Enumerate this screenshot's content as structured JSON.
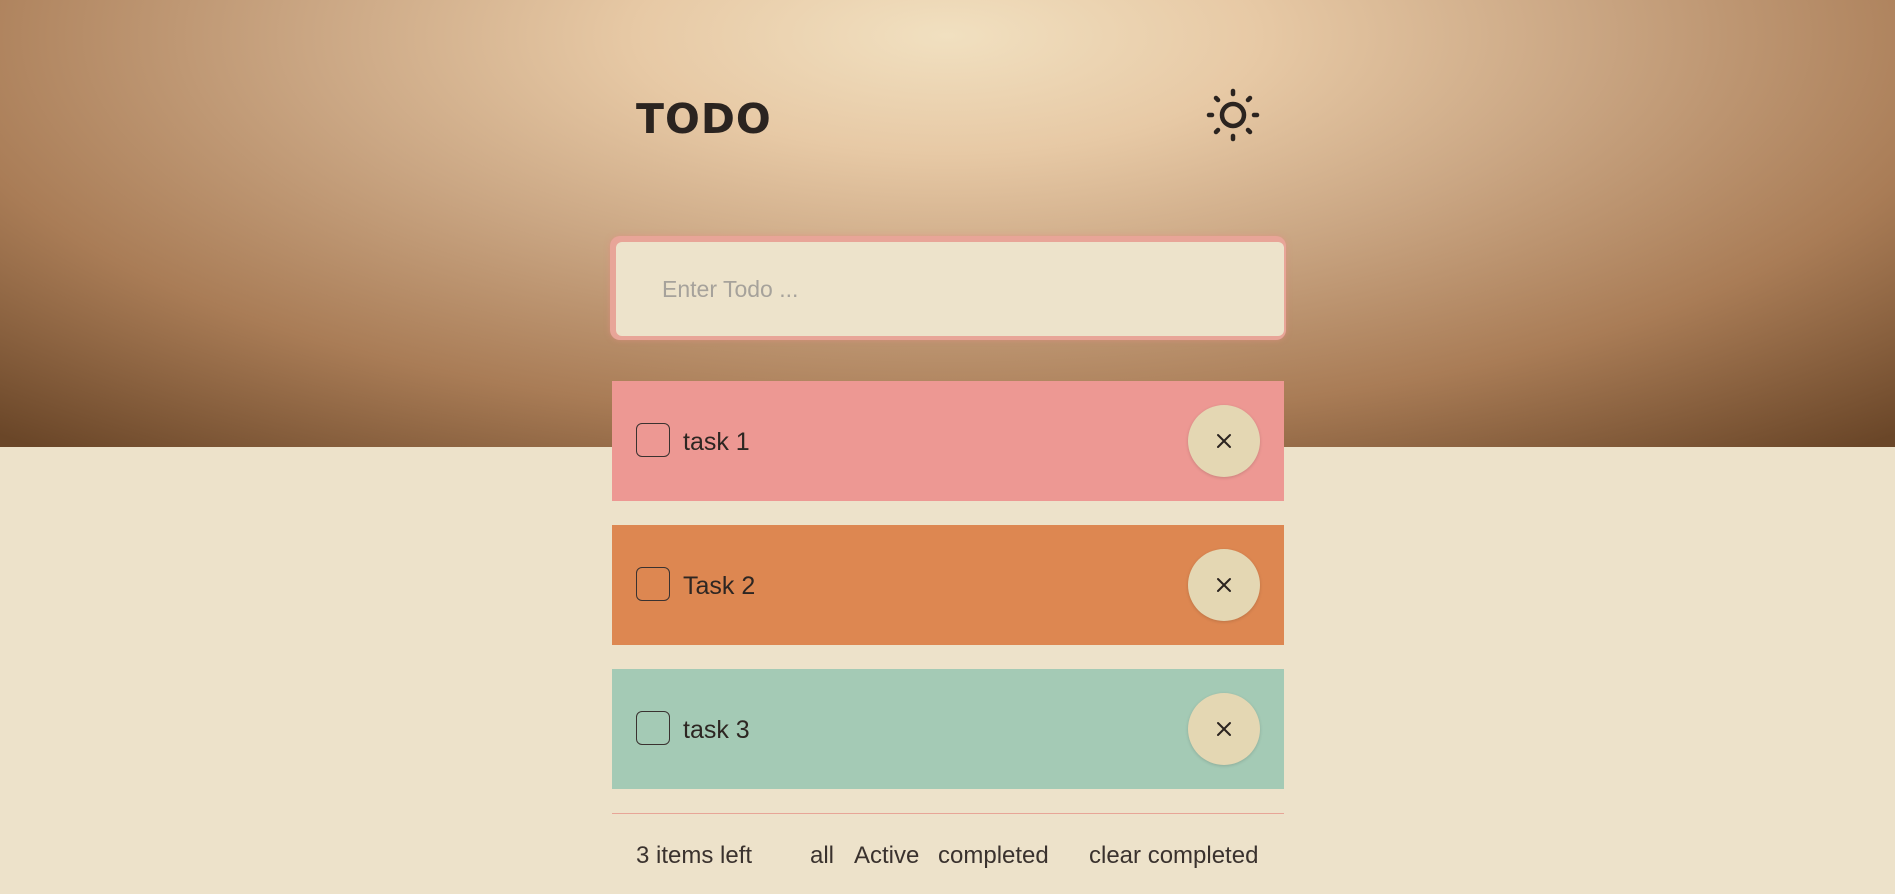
{
  "header": {
    "title": "TODO",
    "theme_toggle_icon": "sun-icon"
  },
  "input": {
    "placeholder": "Enter Todo ...",
    "value": ""
  },
  "todos": [
    {
      "label": "task 1",
      "color": "#ed9893",
      "completed": false
    },
    {
      "label": "Task 2",
      "color": "#dd8751",
      "completed": false
    },
    {
      "label": "task 3",
      "color": "#a4cab5",
      "completed": false
    }
  ],
  "footer": {
    "items_left": "3 items left",
    "filter_all": "all",
    "filter_active": "Active",
    "filter_completed": "completed",
    "clear_completed": "clear completed"
  },
  "colors": {
    "background": "#ede2ca",
    "input_border": "#e8a598",
    "delete_button": "#e4d7b3"
  }
}
